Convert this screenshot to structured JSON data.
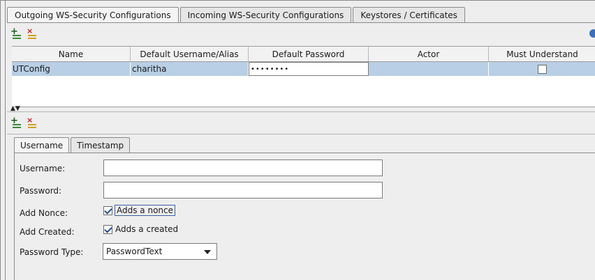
{
  "tabs": [
    {
      "label": "Outgoing WS-Security Configurations",
      "active": true
    },
    {
      "label": "Incoming WS-Security Configurations",
      "active": false
    },
    {
      "label": "Keystores / Certificates",
      "active": false
    }
  ],
  "table": {
    "columns": [
      "Name",
      "Default Username/Alias",
      "Default Password",
      "Actor",
      "Must Understand"
    ],
    "rows": [
      {
        "name": "UTConfig",
        "username": "charitha",
        "password": "••••••••",
        "actor": "",
        "must_understand": false
      }
    ]
  },
  "splitter": {
    "glyph": "▲▼"
  },
  "entry_tabs": [
    {
      "label": "Username",
      "active": true
    },
    {
      "label": "Timestamp",
      "active": false
    }
  ],
  "form": {
    "username_label": "Username:",
    "username_value": "",
    "password_label": "Password:",
    "password_value": "",
    "add_nonce_label": "Add Nonce:",
    "add_nonce_text": "Adds a nonce",
    "add_nonce_checked": true,
    "add_created_label": "Add Created:",
    "add_created_text": "Adds a created",
    "add_created_checked": true,
    "password_type_label": "Password Type:",
    "password_type_value": "PasswordText"
  },
  "colors": {
    "selection": "#b8cfe5",
    "icon_add": "#1f5a1f",
    "icon_delete": "#c81e1e"
  },
  "icons": [
    "add-config-icon",
    "remove-config-icon",
    "add-entry-icon",
    "remove-entry-icon",
    "info-circle-icon"
  ]
}
